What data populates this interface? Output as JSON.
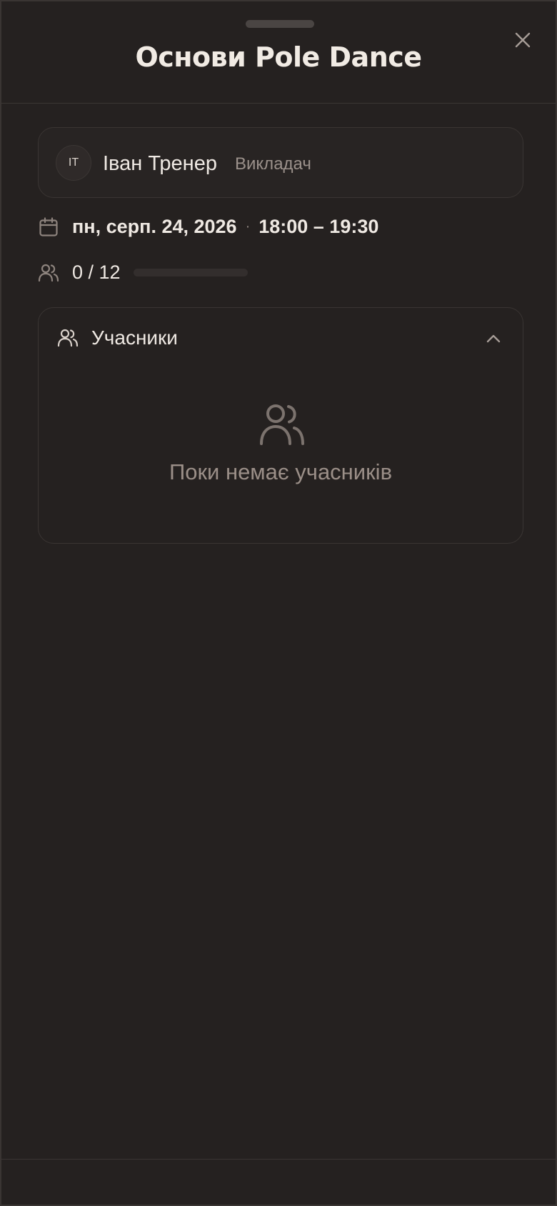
{
  "sheet": {
    "title": "Основи Pole Dance"
  },
  "trainer": {
    "initials": "ІТ",
    "name": "Іван Тренер",
    "role": "Викладач"
  },
  "schedule": {
    "date": "пн, серп. 24, 2026",
    "separator": "·",
    "time": "18:00 – 19:30"
  },
  "capacity": {
    "text": "0 / 12",
    "booked": 0,
    "max": 12,
    "fill_fraction": 0
  },
  "participants": {
    "title": "Учасники",
    "empty_text": "Поки немає учасників",
    "expanded": true
  },
  "icons": {
    "close": "close-icon",
    "calendar": "calendar-icon",
    "users": "users-icon",
    "chevron": "chevron-up-icon"
  },
  "colors": {
    "background": "#252120",
    "border": "#3a3533",
    "text": "#efe9e3",
    "muted": "#9b918b",
    "icon": "#8e847e"
  }
}
